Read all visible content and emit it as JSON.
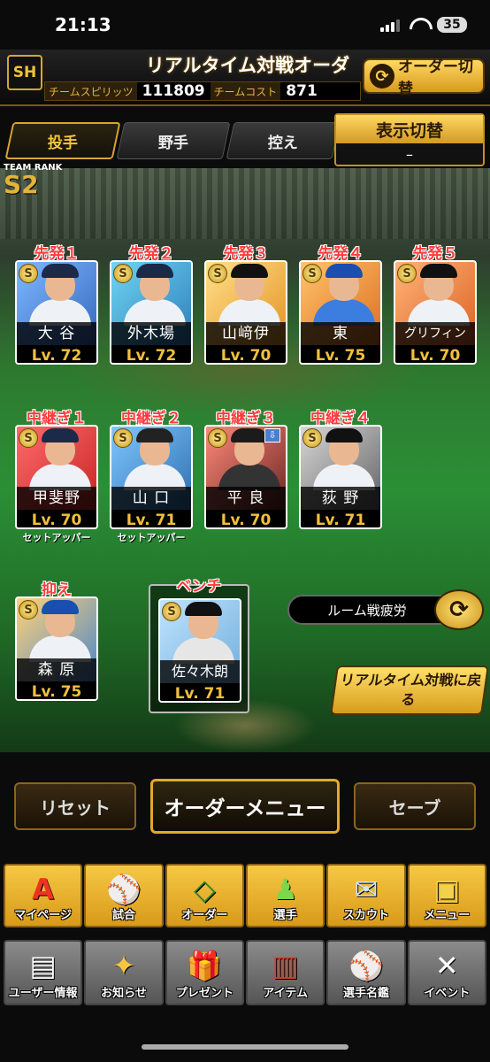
{
  "status": {
    "time": "21:13",
    "battery": "35"
  },
  "header": {
    "logo": "SH",
    "title": "リアルタイム対戦オーダー",
    "spirits_label": "チームスピリッツ",
    "spirits_value": "111809",
    "cost_label": "チームコスト",
    "cost_value": "871",
    "switch_order_label": "オーダー切替"
  },
  "tabs": [
    {
      "label": "投手",
      "active": true
    },
    {
      "label": "野手",
      "active": false
    },
    {
      "label": "控え",
      "active": false
    }
  ],
  "display_switch": {
    "label": "表示切替",
    "value": "–"
  },
  "team_rank": {
    "label": "TEAM RANK",
    "value": "S2"
  },
  "starters": [
    {
      "role": "先発１",
      "name": "大 谷",
      "level": "Lv. 72"
    },
    {
      "role": "先発２",
      "name": "外木場",
      "level": "Lv. 72"
    },
    {
      "role": "先発３",
      "name": "山﨑伊",
      "level": "Lv. 70"
    },
    {
      "role": "先発４",
      "name": "東",
      "level": "Lv. 75"
    },
    {
      "role": "先発５",
      "name": "グリフィン",
      "level": "Lv. 70"
    }
  ],
  "relievers": [
    {
      "role": "中継ぎ１",
      "name": "甲斐野",
      "level": "Lv. 70",
      "sub": "セットアッパー"
    },
    {
      "role": "中継ぎ２",
      "name": "山 口",
      "level": "Lv. 71",
      "sub": "セットアッパー"
    },
    {
      "role": "中継ぎ３",
      "name": "平 良",
      "level": "Lv. 70",
      "sub": ""
    },
    {
      "role": "中継ぎ４",
      "name": "荻 野",
      "level": "Lv. 71",
      "sub": ""
    }
  ],
  "closer": {
    "role": "抑え",
    "name": "森 原",
    "level": "Lv. 75"
  },
  "bench": {
    "role": "ベンチ",
    "name": "佐々木朗",
    "level": "Lv. 71"
  },
  "room_fatigue_label": "ルーム戦疲労",
  "back_to_realtime_label": "リアルタイム対戦に戻る",
  "buttons": {
    "reset": "リセット",
    "order_menu": "オーダーメニュー",
    "save": "セーブ"
  },
  "nav_top": [
    {
      "label": "マイページ",
      "icon": "A"
    },
    {
      "label": "試合",
      "icon": "⚾"
    },
    {
      "label": "オーダー",
      "icon": "◇"
    },
    {
      "label": "選手",
      "icon": "♟"
    },
    {
      "label": "スカウト",
      "icon": "✉"
    },
    {
      "label": "メニュー",
      "icon": "▣"
    }
  ],
  "nav_bottom": [
    {
      "label": "ユーザー情報",
      "icon": "▤"
    },
    {
      "label": "お知らせ",
      "icon": "✦"
    },
    {
      "label": "プレゼント",
      "icon": "🎁"
    },
    {
      "label": "アイテム",
      "icon": "▥"
    },
    {
      "label": "選手名鑑",
      "icon": "⚾"
    },
    {
      "label": "イベント",
      "icon": "✕"
    }
  ]
}
